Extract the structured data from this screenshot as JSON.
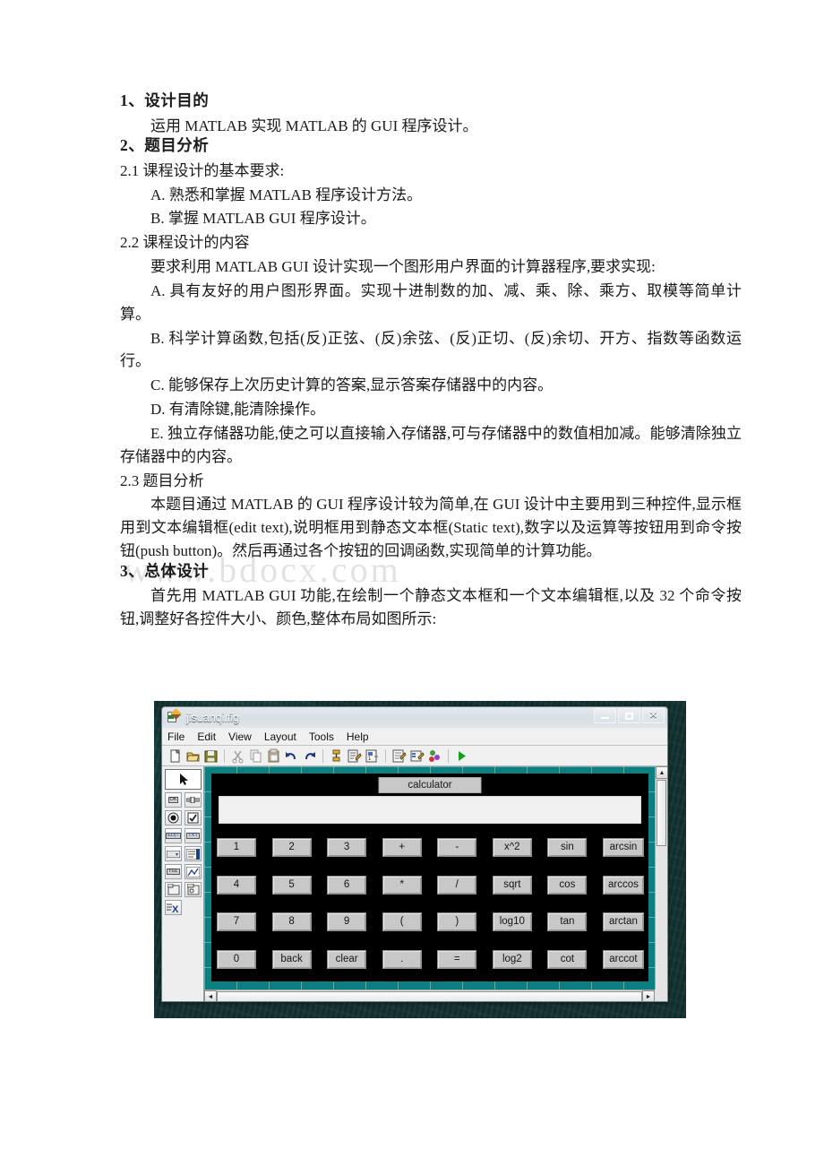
{
  "document": {
    "sections": [
      {
        "type": "heading",
        "text": "1、设计目的"
      },
      {
        "type": "para_indent",
        "text": "运用 MATLAB 实现 MATLAB 的 GUI 程序设计。"
      },
      {
        "type": "heading",
        "text": "2、题目分析"
      },
      {
        "type": "para",
        "text": "2.1 课程设计的基本要求:"
      },
      {
        "type": "para_sub",
        "text": "A. 熟悉和掌握 MATLAB 程序设计方法。"
      },
      {
        "type": "para_sub",
        "text": "B. 掌握 MATLAB GUI 程序设计。"
      },
      {
        "type": "para",
        "text": "2.2 课程设计的内容"
      },
      {
        "type": "para_indent",
        "text": "要求利用 MATLAB GUI 设计实现一个图形用户界面的计算器程序,要求实现:"
      },
      {
        "type": "para_indent",
        "text": "A. 具有友好的用户图形界面。实现十进制数的加、减、乘、除、乘方、取模等简单计算。"
      },
      {
        "type": "para_indent",
        "text": "B. 科学计算函数,包括(反)正弦、(反)余弦、(反)正切、(反)余切、开方、指数等函数运行。"
      },
      {
        "type": "para_indent",
        "text": "C.  能够保存上次历史计算的答案,显示答案存储器中的内容。"
      },
      {
        "type": "para_indent",
        "text": "D. 有清除键,能清除操作。"
      },
      {
        "type": "para_indent",
        "text": "E. 独立存储器功能,使之可以直接输入存储器,可与存储器中的数值相加减。能够清除独立存储器中的内容。"
      },
      {
        "type": "para",
        "text": "2.3 题目分析"
      },
      {
        "type": "para_indent",
        "text": "本题目通过 MATLAB 的 GUI 程序设计较为简单,在 GUI 设计中主要用到三种控件,显示框用到文本编辑框(edit text),说明框用到静态文本框(Static text),数字以及运算等按钮用到命令按钮(push button)。然后再通过各个按钮的回调函数,实现简单的计算功能。"
      },
      {
        "type": "heading",
        "text": "3、总体设计"
      },
      {
        "type": "para_indent",
        "text": "首先用 MATLAB GUI 功能,在绘制一个静态文本框和一个文本编辑框,以及 32 个命令按钮,调整好各控件大小、颜色,整体布局如图所示:"
      }
    ],
    "watermark": "www.bdocx.com"
  },
  "screenshot": {
    "window": {
      "title": "jisuanqi.fig",
      "icon": "guide-figure-icon",
      "controls": {
        "minimize": "minimize-icon",
        "maximize": "maximize-icon",
        "close": "✕"
      }
    },
    "menubar": [
      "File",
      "Edit",
      "View",
      "Layout",
      "Tools",
      "Help"
    ],
    "toolbar": [
      "new-file-icon",
      "open-folder-icon",
      "save-disk-icon",
      "separator",
      "cut-scissors-icon",
      "copy-icon",
      "paste-icon",
      "undo-arrow-icon",
      "redo-arrow-icon",
      "separator",
      "align-objects-icon",
      "menu-editor-icon",
      "tab-order-editor-icon",
      "separator",
      "m-file-editor-icon",
      "property-inspector-icon",
      "object-browser-icon",
      "separator",
      "run-play-icon"
    ],
    "palette": [
      {
        "name": "select-arrow-tool",
        "glyph": "arrow",
        "selected": true
      },
      {
        "name": "push-button-tool",
        "glyph": "OK"
      },
      {
        "name": "slider-tool",
        "glyph": "slider"
      },
      {
        "name": "radio-button-tool",
        "glyph": "radio"
      },
      {
        "name": "check-box-tool",
        "glyph": "check"
      },
      {
        "name": "edit-text-tool",
        "glyph": "EDIT"
      },
      {
        "name": "static-text-tool",
        "glyph": "TXT"
      },
      {
        "name": "pop-up-menu-tool",
        "glyph": "popup"
      },
      {
        "name": "list-box-tool",
        "glyph": "list"
      },
      {
        "name": "toggle-button-tool",
        "glyph": "TGL"
      },
      {
        "name": "axes-tool",
        "glyph": "axes"
      },
      {
        "name": "panel-tool",
        "glyph": "panel"
      },
      {
        "name": "button-group-tool",
        "glyph": "group"
      },
      {
        "name": "activex-control-tool",
        "glyph": "X"
      }
    ],
    "figure": {
      "static_text_label": "calculator",
      "edit_text_value": "",
      "button_rows": [
        [
          "1",
          "2",
          "3",
          "+",
          "-",
          "x^2",
          "sin",
          "arcsin"
        ],
        [
          "4",
          "5",
          "6",
          "*",
          "/",
          "sqrt",
          "cos",
          "arccos"
        ],
        [
          "7",
          "8",
          "9",
          "(",
          ")",
          "log10",
          "tan",
          "arctan"
        ],
        [
          "0",
          "back",
          "clear",
          ".",
          "=",
          "log2",
          "cot",
          "arccot"
        ]
      ]
    },
    "scrollbars": {
      "vertical_up": "▲",
      "vertical_down": "▼",
      "horizontal_left": "◄",
      "horizontal_right": "►"
    },
    "colors": {
      "canvas_teal": "#0c8080",
      "figure_black": "#000000",
      "button_gray": "#c8c8c8",
      "edit_field": "#f0f0f0"
    }
  }
}
